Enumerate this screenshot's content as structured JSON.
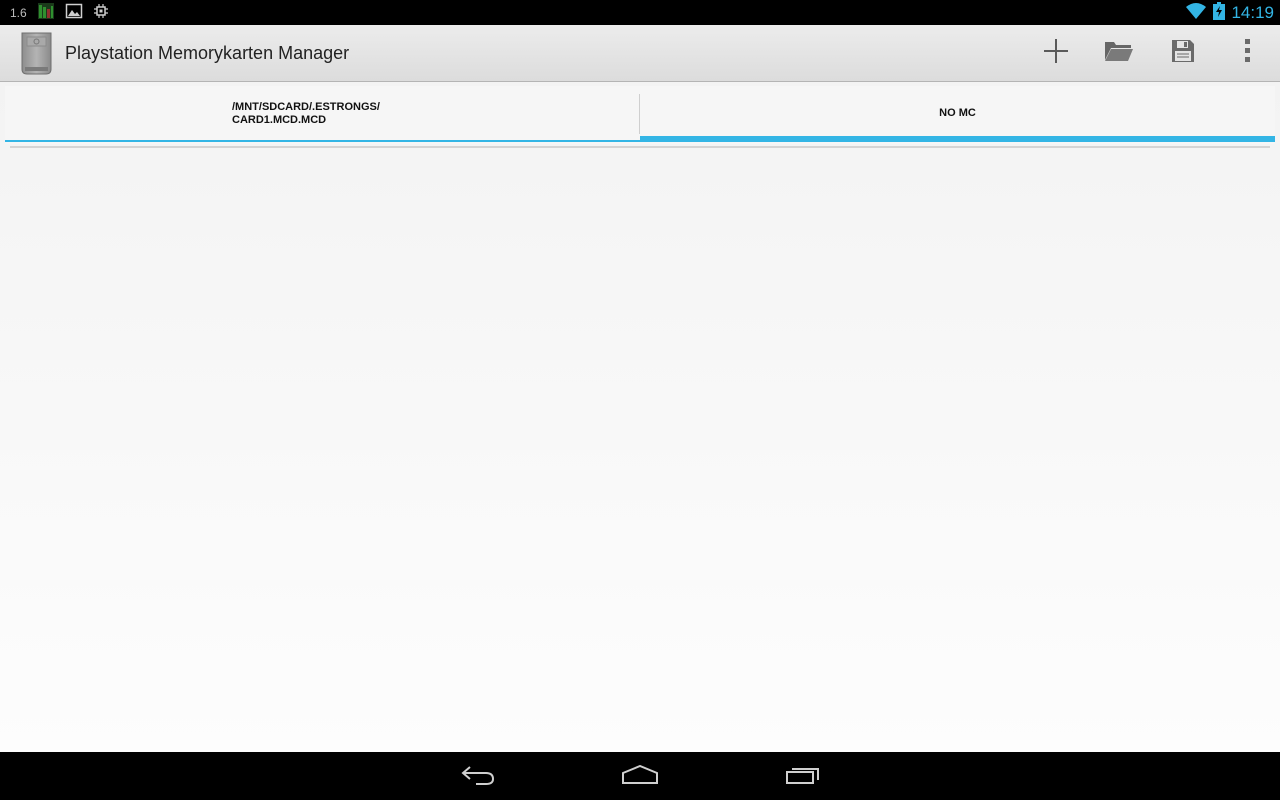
{
  "status_bar": {
    "left_text": "1.6",
    "icons": [
      "signal-meter-icon",
      "gallery-icon",
      "chip-icon"
    ],
    "clock": "14:19",
    "right_icons": [
      "wifi-icon",
      "battery-charging-icon"
    ]
  },
  "action_bar": {
    "app_icon": "memory-card-icon",
    "title": "Playstation Memorykarten Manager",
    "actions": [
      "add-icon",
      "open-folder-icon",
      "save-icon",
      "overflow-menu-icon"
    ]
  },
  "tabs": [
    {
      "label_line1": "/MNT/SDCARD/.ESTRONGS/",
      "label_line2": "CARD1.MCD.MCD"
    },
    {
      "label": "NO MC"
    }
  ],
  "nav_bar": {
    "buttons": [
      "back-icon",
      "home-icon",
      "recents-icon"
    ]
  },
  "colors": {
    "accent": "#33b5e5",
    "status_bar": "#000000",
    "action_bar": "#e6e6e6"
  }
}
